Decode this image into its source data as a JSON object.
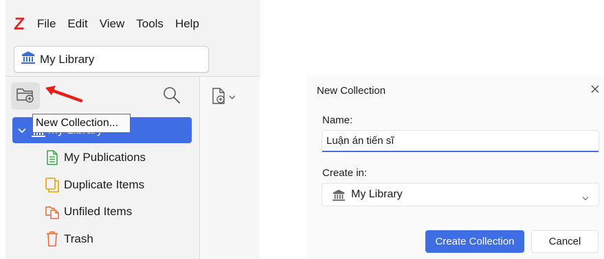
{
  "app": {
    "logo": "Z",
    "menu": [
      "File",
      "Edit",
      "View",
      "Tools",
      "Help"
    ],
    "library_selector": "My Library",
    "tooltip": "New Collection...",
    "selected_library_label": "My Library",
    "tree_items": [
      {
        "label": "My Publications",
        "icon": "publications-icon",
        "color": "#37a34a"
      },
      {
        "label": "Duplicate Items",
        "icon": "duplicate-items-icon",
        "color": "#e8a100"
      },
      {
        "label": "Unfiled Items",
        "icon": "unfiled-items-icon",
        "color": "#ea6a38"
      },
      {
        "label": "Trash",
        "icon": "trash-icon",
        "color": "#ea6a38"
      }
    ],
    "icons": [
      "new-collection-icon",
      "search-icon",
      "new-item-icon",
      "library-icon",
      "annotation-arrow-icon"
    ],
    "accent_color": "#3f6ee4",
    "logo_color": "#d62c2c",
    "arrow_color": "#e8201c"
  },
  "dialog": {
    "title": "New Collection",
    "name_label": "Name:",
    "name_value": "Luận án tiến sĩ",
    "create_in_label": "Create in:",
    "create_in_value": "My Library",
    "create_button": "Create Collection",
    "cancel_button": "Cancel"
  }
}
